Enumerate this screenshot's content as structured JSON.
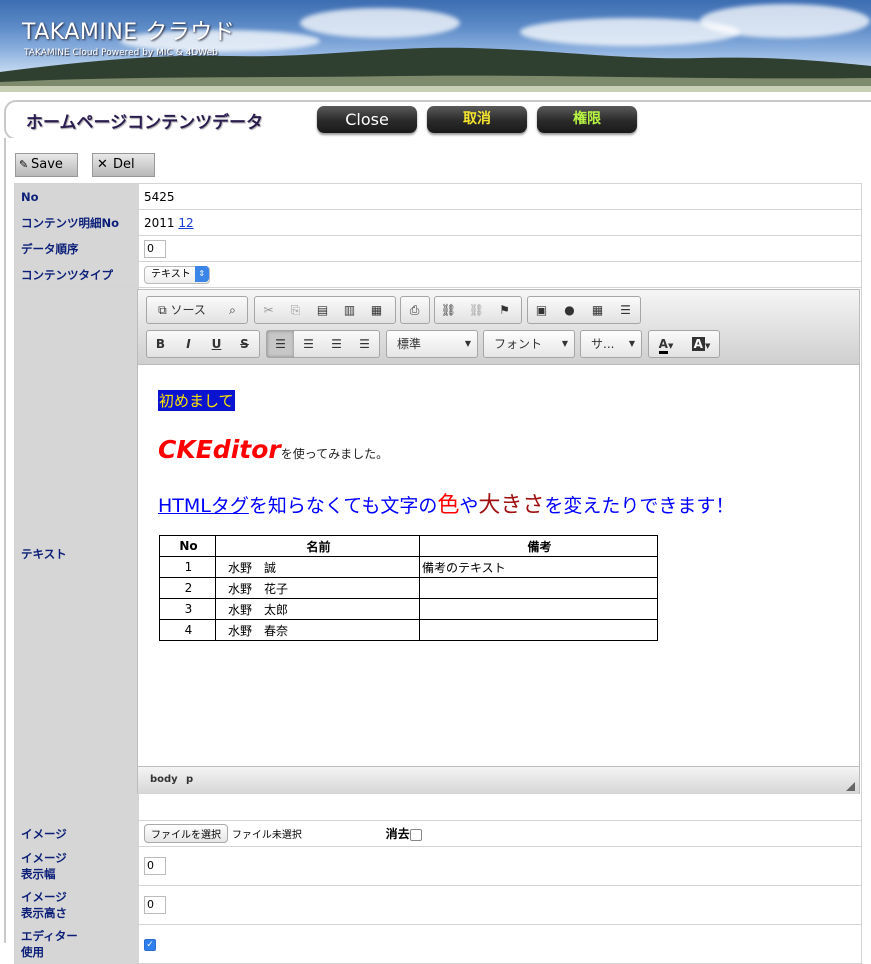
{
  "banner": {
    "title": "TAKAMINE クラウド",
    "subtitle": "TAKAMINE Cloud Powered by MIC & 4DWeb"
  },
  "header": {
    "page_title": "ホームページコンテンツデータ",
    "close_label": "Close",
    "cancel_label": "取消",
    "permission_label": "権限"
  },
  "actions": {
    "save_label": "Save",
    "delete_label": "Del"
  },
  "form": {
    "no_label": "No",
    "no_value": "5425",
    "detail_label": "コンテンツ明細No",
    "detail_value": "2011",
    "detail_link": "12",
    "order_label": "データ順序",
    "order_value": "0",
    "type_label": "コンテンツタイプ",
    "type_value": "テキスト",
    "text_label": "テキスト",
    "image_label": "イメージ",
    "file_button": "ファイルを選択",
    "file_status": "ファイル未選択",
    "erase_label": "消去",
    "image_width_label_1": "イメージ",
    "image_width_label_2": "表示幅",
    "image_width_value": "0",
    "image_height_label_1": "イメージ",
    "image_height_label_2": "表示高さ",
    "image_height_value": "0",
    "editor_label_1": "エディター",
    "editor_label_2": "使用",
    "editor_checked": true
  },
  "editor": {
    "source_label": "ソース",
    "format_combo": "標準",
    "font_combo": "フォント",
    "size_combo": "サ...",
    "line1": "初めまして",
    "line2_big": "CKEditor",
    "line2_small": "を使ってみました。",
    "line3_a": "HTMLタグ",
    "line3_b": "を知らなくても文字の",
    "line3_c": "色",
    "line3_d": "や",
    "line3_e": "大きさ",
    "line3_f": "を変えたりできます！",
    "table_headers": [
      "No",
      "名前",
      "備考"
    ],
    "table_rows": [
      [
        "1",
        "水野　誠",
        "備考のテキスト"
      ],
      [
        "2",
        "水野　花子",
        ""
      ],
      [
        "3",
        "水野　太郎",
        ""
      ],
      [
        "4",
        "水野　春奈",
        ""
      ]
    ],
    "path_body": "body",
    "path_p": "p"
  }
}
